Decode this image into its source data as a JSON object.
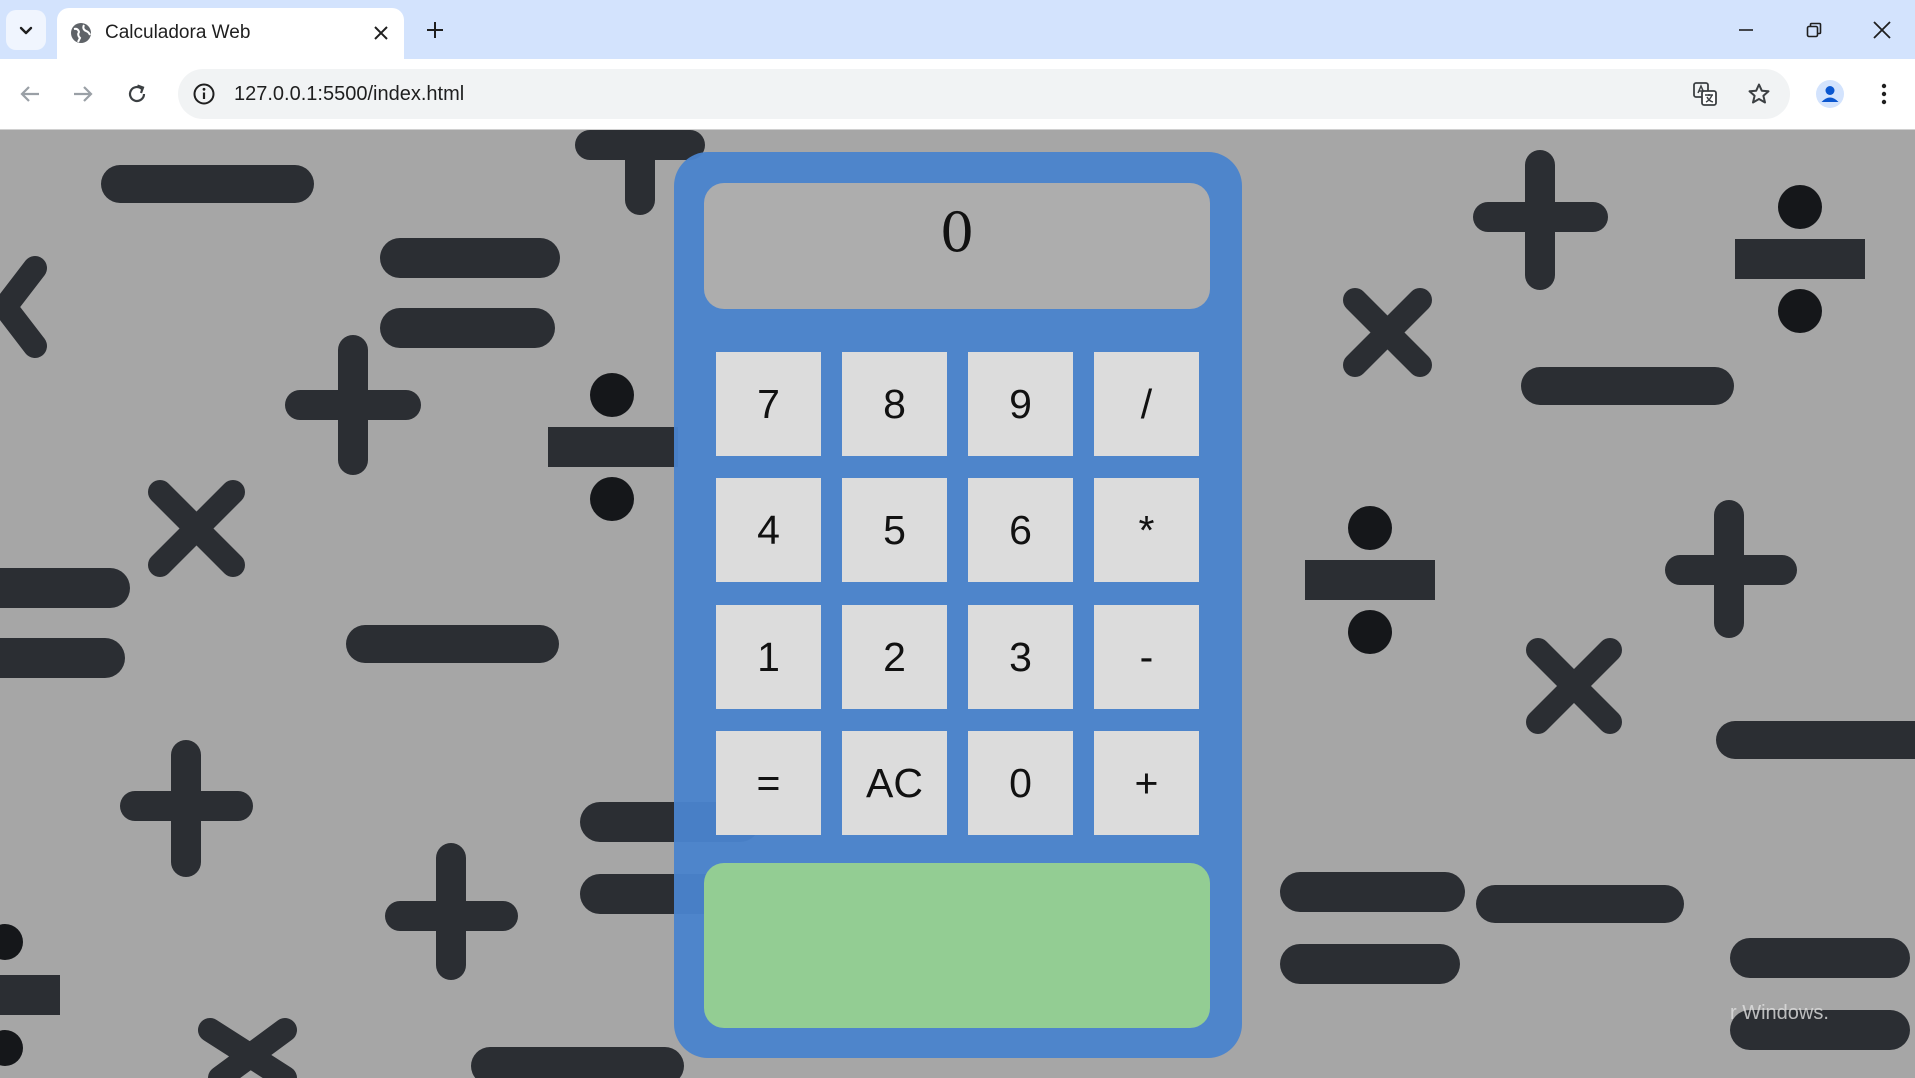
{
  "browser": {
    "tab_title": "Calculadora Web",
    "url": "127.0.0.1:5500/index.html"
  },
  "calculator": {
    "display_value": "0",
    "keys": [
      "7",
      "8",
      "9",
      "/",
      "4",
      "5",
      "6",
      "*",
      "1",
      "2",
      "3",
      "-",
      "=",
      "AC",
      "0",
      "+"
    ],
    "result_value": ""
  },
  "watermark_text": "r Windows.",
  "colors": {
    "tab_strip": "#d3e3fd",
    "page_background": "#a6a6a6",
    "symbol": "#2b2e33",
    "calculator_body": "#4a83cc",
    "display": "#adadad",
    "key": "#dcdcdc",
    "result_panel": "#93cd93"
  }
}
